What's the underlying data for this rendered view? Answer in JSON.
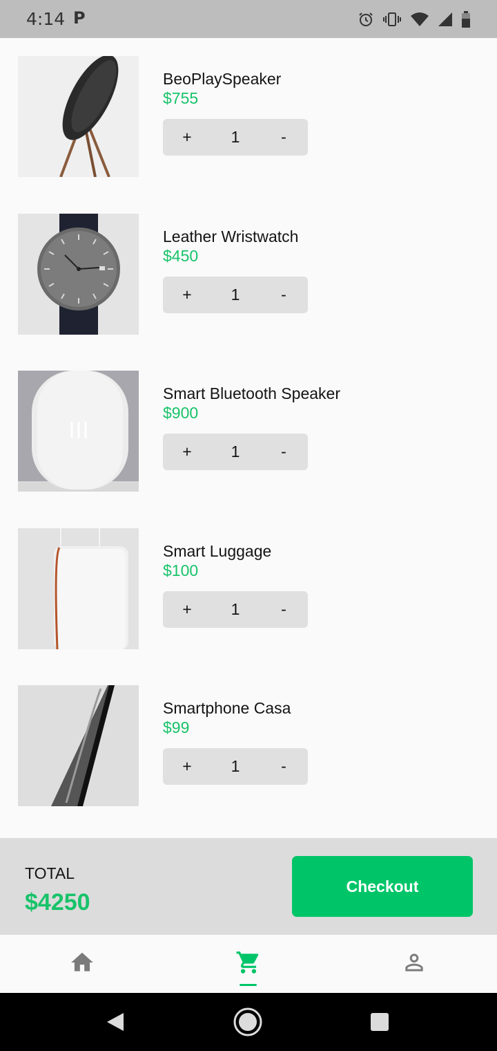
{
  "status_bar": {
    "time": "4:14",
    "notification_glyph": "P",
    "icons": [
      "alarm-icon",
      "vibrate-icon",
      "wifi-icon",
      "signal-icon",
      "battery-icon"
    ]
  },
  "cart": {
    "items": [
      {
        "name": "BeoPlaySpeaker",
        "price": "$755",
        "quantity": "1"
      },
      {
        "name": "Leather Wristwatch",
        "price": "$450",
        "quantity": "1"
      },
      {
        "name": "Smart Bluetooth Speaker",
        "price": "$900",
        "quantity": "1"
      },
      {
        "name": "Smart Luggage",
        "price": "$100",
        "quantity": "1"
      },
      {
        "name": "Smartphone Casa",
        "price": "$99",
        "quantity": "1"
      }
    ],
    "increment_label": "+",
    "decrement_label": "-"
  },
  "summary": {
    "total_label": "TOTAL",
    "total_value": "$4250",
    "checkout_label": "Checkout"
  },
  "bottom_nav": {
    "items": [
      "home-icon",
      "cart-icon",
      "person-icon"
    ],
    "active": "cart-icon"
  },
  "colors": {
    "accent": "#00c568",
    "price": "#18c36a",
    "status_bar": "#bdbdbd",
    "stepper": "#e0e0e0",
    "summary_bar": "#dcdcdc"
  }
}
